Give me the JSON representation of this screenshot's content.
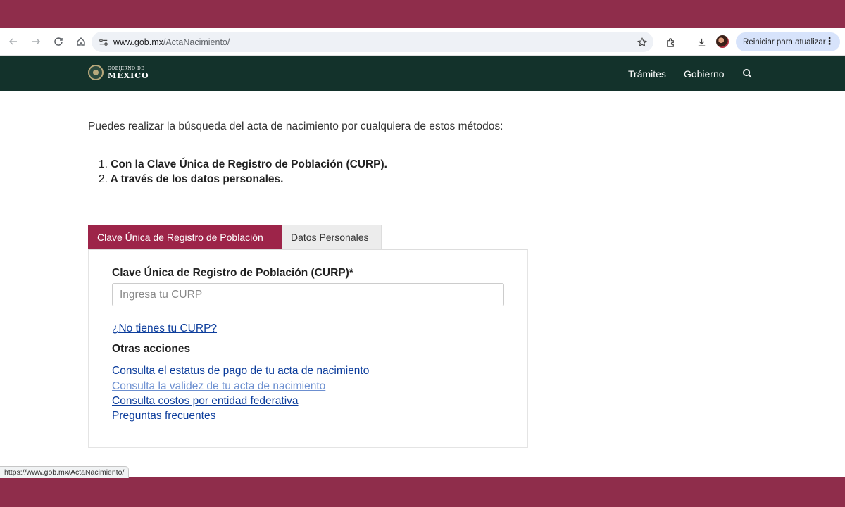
{
  "browser": {
    "url_domain": "www.gob.mx",
    "url_path": "/ActaNacimiento/",
    "update_button": "Reiniciar para atualizar",
    "status_url": "https://www.gob.mx/ActaNacimiento/"
  },
  "header": {
    "logo_small": "GOBIERNO DE",
    "logo_big": "MÉXICO",
    "nav": [
      "Trámites",
      "Gobierno"
    ]
  },
  "main": {
    "intro": "Puedes realizar la búsqueda del acta de nacimiento por cualquiera de estos métodos:",
    "methods": [
      {
        "num": "1.",
        "text": "Con la Clave Única de Registro de Población (CURP)."
      },
      {
        "num": "2.",
        "text": "A través de los datos personales."
      }
    ],
    "tabs": [
      {
        "label": "Clave Única de Registro de Población"
      },
      {
        "label": "Datos Personales"
      }
    ],
    "form": {
      "label": "Clave Única de Registro de Población (CURP)*",
      "placeholder": "Ingresa tu CURP",
      "no_curp_link": "¿No tienes tu CURP?",
      "other_actions_title": "Otras acciones",
      "links": [
        "Consulta el estatus de pago de tu acta de nacimiento",
        "Consulta la validez de tu acta de nacimiento",
        "Consulta costos por entidad federativa",
        "Preguntas frecuentes"
      ]
    }
  },
  "colors": {
    "frame": "#8f2d4b",
    "header_bg": "#13322b",
    "tab_active": "#9d2449",
    "link": "#0c3d9c"
  }
}
